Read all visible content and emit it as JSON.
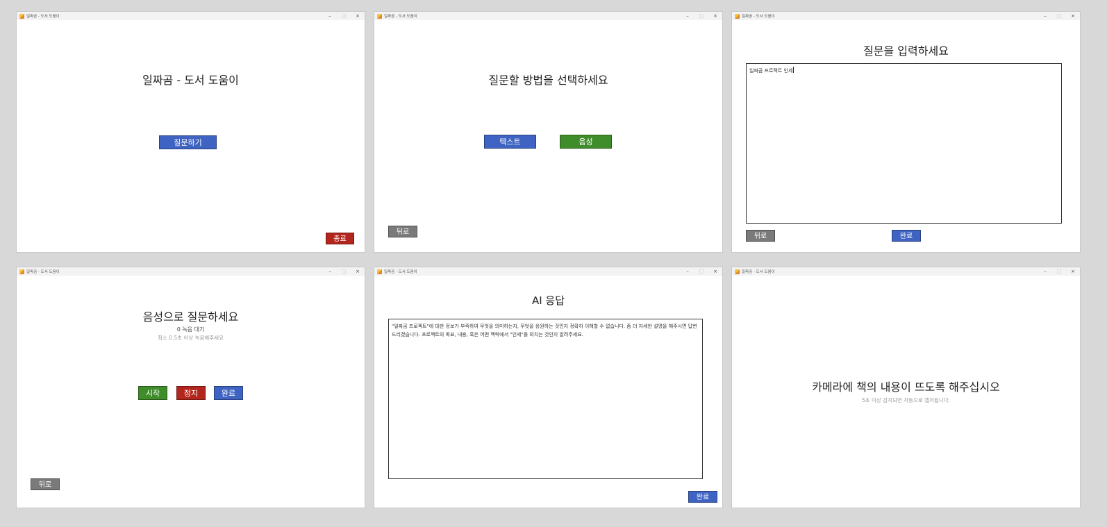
{
  "window_title": "일짜곰 - 도서 도움이",
  "window_controls": {
    "minimize": "–",
    "maximize": "□",
    "close": "×"
  },
  "colors": {
    "blue": "#3e63c2",
    "green": "#3f8d2a",
    "red": "#b3261e",
    "gray": "#7a7a7a"
  },
  "screens": {
    "home": {
      "title": "일짜곰 - 도서 도움이",
      "ask_button": "질문하기",
      "exit_button": "종료"
    },
    "method": {
      "title": "질문할 방법을 선택하세요",
      "text_button": "텍스트",
      "voice_button": "음성",
      "back_button": "뒤로"
    },
    "text_input": {
      "title": "질문을 입력하세요",
      "input_value": "일짜곰 프로젝트 인세",
      "back_button": "뒤로",
      "done_button": "완료"
    },
    "voice": {
      "title": "음성으로 질문하세요",
      "status": "0 녹음 대기",
      "hint": "최소 0.5초 이상 녹음해주세요",
      "start_button": "시작",
      "stop_button": "정지",
      "done_button": "완료",
      "back_button": "뒤로"
    },
    "ai_response": {
      "title": "AI 응답",
      "response_text": "\"일짜곰 프로젝트\"에 대한 정보가 부족하여 무엇을 의미하는지, 무엇을 응원하는 것인지 정확히 이해할 수 없습니다. 좀 더 자세한 설명을 해주시면 답변드리겠습니다. 프로젝트의 목표, 내용, 혹은 어떤 맥락에서 \"인세\"를 외치는 것인지 알려주세요.",
      "done_button": "완료"
    },
    "camera": {
      "title": "카메라에 책의 내용이 뜨도록 해주십시오",
      "hint": "5초 이상 감지되면 자동으로 캡처됩니다."
    }
  }
}
